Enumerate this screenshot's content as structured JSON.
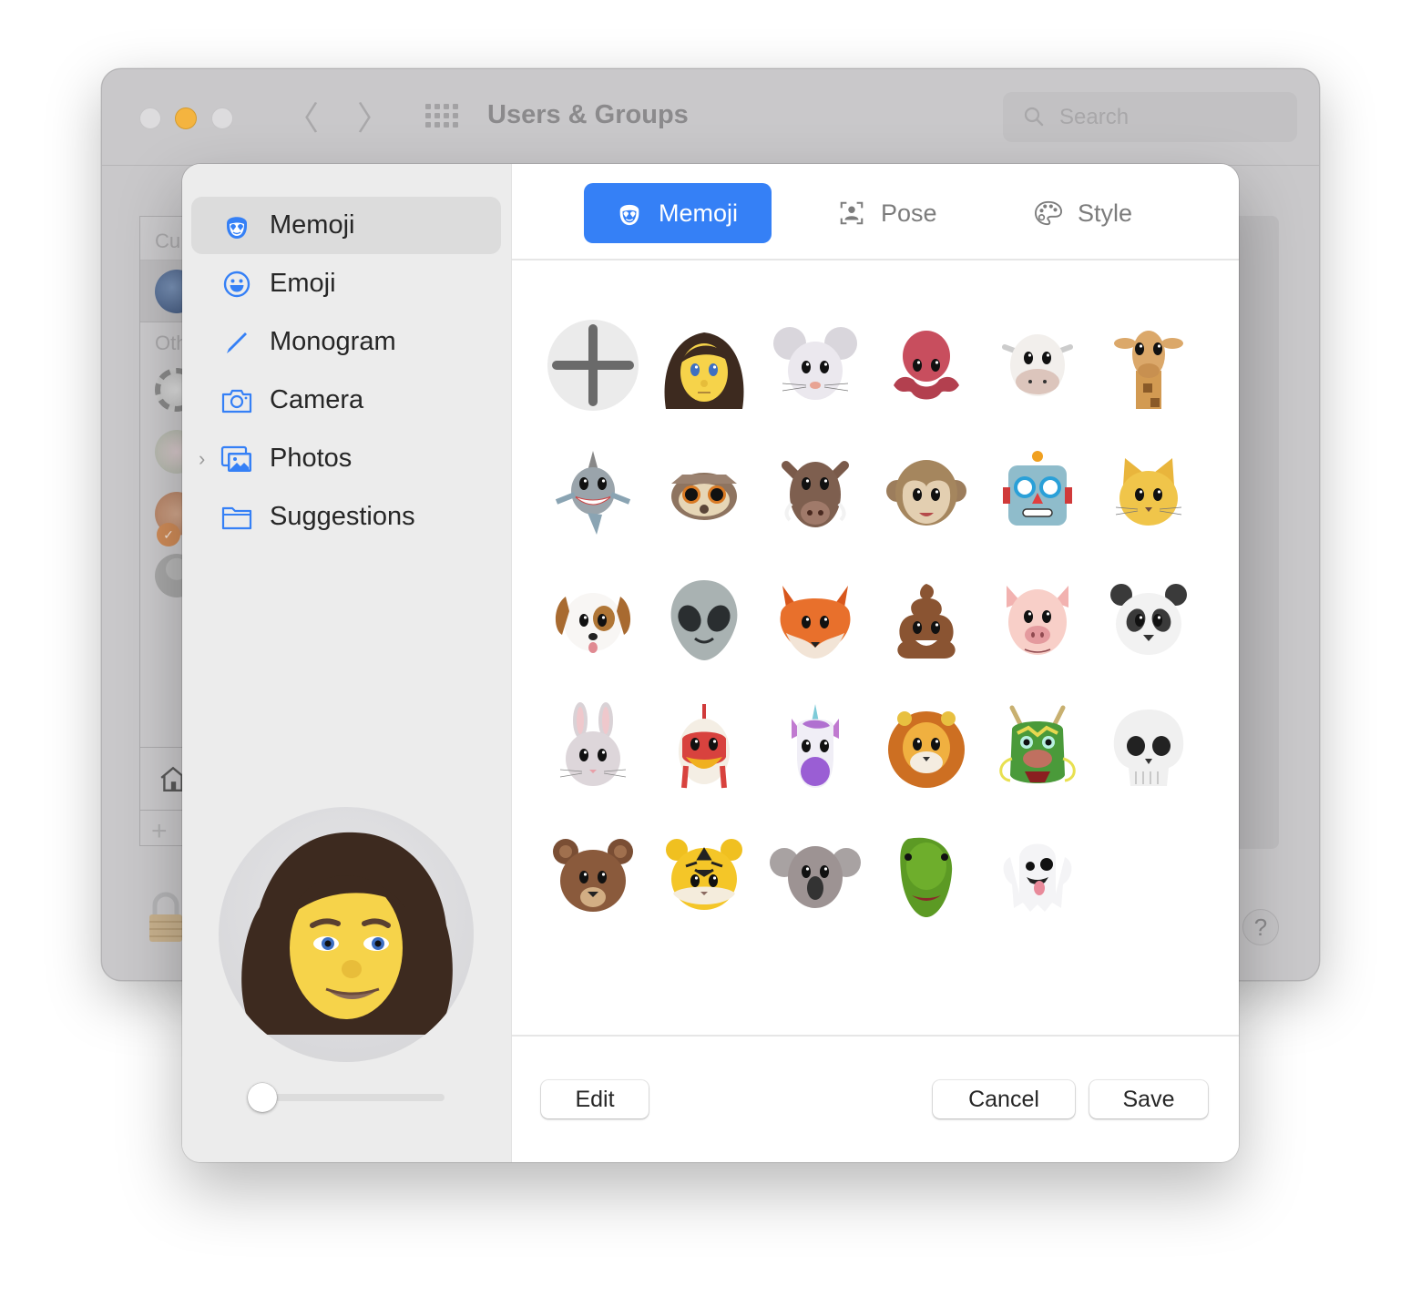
{
  "window": {
    "title": "Users & Groups",
    "search_placeholder": "Search",
    "traffic_lights": [
      "close",
      "minimize",
      "zoom"
    ],
    "list_header_partial": "Cu",
    "list_other_partial": "Oth",
    "help_label": "?"
  },
  "sheet": {
    "sidebar": {
      "items": [
        {
          "label": "Memoji",
          "icon": "memoji-face-icon",
          "selected": true
        },
        {
          "label": "Emoji",
          "icon": "smiley-icon",
          "selected": false
        },
        {
          "label": "Monogram",
          "icon": "pencil-icon",
          "selected": false
        },
        {
          "label": "Camera",
          "icon": "camera-icon",
          "selected": false
        },
        {
          "label": "Photos",
          "icon": "photos-icon",
          "selected": false,
          "expandable": true
        },
        {
          "label": "Suggestions",
          "icon": "folder-icon",
          "selected": false
        }
      ]
    },
    "preview": {
      "avatar": "memoji-woman-curly-hair-smiling",
      "zoom_slider_value": 0
    },
    "tabs": [
      {
        "label": "Memoji",
        "icon": "memoji-face-icon",
        "active": true
      },
      {
        "label": "Pose",
        "icon": "pose-frame-icon",
        "active": false
      },
      {
        "label": "Style",
        "icon": "palette-icon",
        "active": false
      }
    ],
    "grid": {
      "add_label": "+",
      "items": [
        "memoji-woman",
        "mouse",
        "octopus",
        "cow",
        "giraffe",
        "shark",
        "owl",
        "boar",
        "monkey",
        "robot",
        "cat",
        "dog",
        "alien",
        "fox",
        "poop",
        "pig",
        "panda",
        "rabbit",
        "chicken",
        "unicorn",
        "lion",
        "dragon",
        "skull",
        "bear",
        "tiger",
        "koala",
        "t-rex",
        "ghost"
      ]
    },
    "buttons": {
      "edit": "Edit",
      "cancel": "Cancel",
      "save": "Save"
    },
    "colors": {
      "accent": "#3580f6",
      "sidebar_bg": "#ececec",
      "selected_bg": "#dcdcdc"
    }
  }
}
